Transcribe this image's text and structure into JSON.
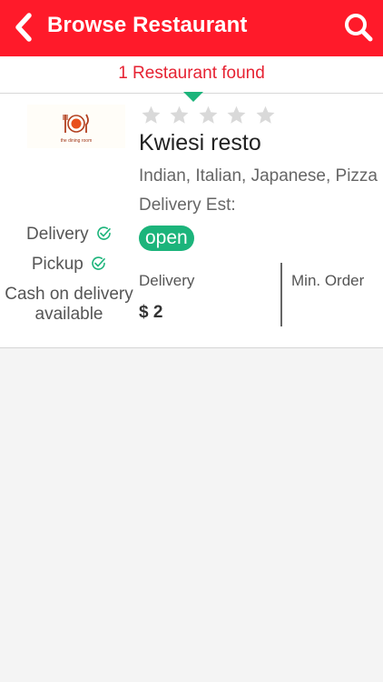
{
  "header": {
    "title": "Browse Restaurant",
    "back_icon": "chevron-left-icon",
    "search_icon": "search-icon",
    "background_color": "#ff1a2a"
  },
  "results": {
    "found_text": "1 Restaurant found",
    "found_color": "#e62232"
  },
  "restaurant": {
    "logo_text": "the dining room",
    "rating_stars_filled": 0,
    "rating_stars_total": 5,
    "name": "Kwiesi resto",
    "cuisines": "Indian, Italian, Japanese, Pizza",
    "delivery_est_label": "Delivery Est:",
    "status": "open",
    "status_color": "#1cb47b",
    "services": {
      "delivery": "Delivery",
      "pickup": "Pickup",
      "cod_line1": "Cash on delivery",
      "cod_line2": "available"
    },
    "delivery_fee_label": "Delivery",
    "delivery_fee_value": "$ 2",
    "min_order_label": "Min. Order"
  }
}
